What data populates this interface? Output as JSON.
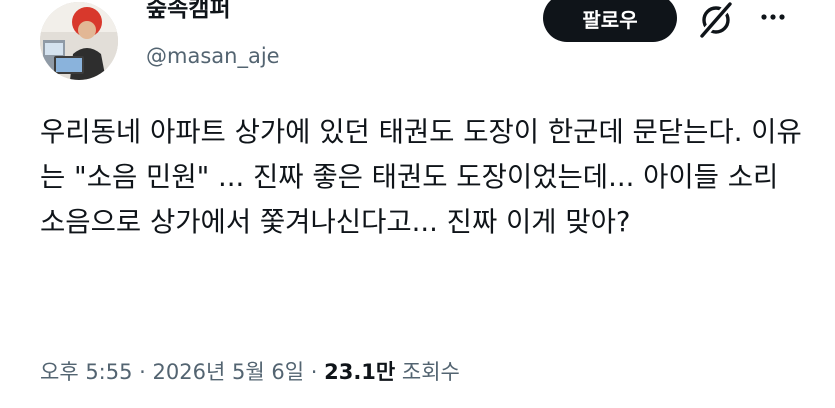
{
  "author": {
    "display_name": "숲속캠퍼",
    "handle": "@masan_aje",
    "avatar_icon": "avatar-photo"
  },
  "actions": {
    "follow_label": "팔로우",
    "grok_icon": "grok-icon",
    "more_icon": "more-icon"
  },
  "tweet": {
    "text": "우리동네 아파트 상가에 있던 태권도 도장이 한군데 문닫는다. 이유는 \"소음 민원\" ... 진짜 좋은 태권도 도장이었는데... 아이들 소리 소음으로 상가에서 쫓겨나신다고... 진짜 이게 맞아?"
  },
  "meta": {
    "time": "오후 5:55",
    "separator": "·",
    "date": "2026년 5월 6일",
    "views_count": "23.1만",
    "views_label": "조회수"
  },
  "colors": {
    "text_primary": "#0f1419",
    "text_secondary": "#536471",
    "button_bg": "#0f1419",
    "background": "#ffffff"
  }
}
